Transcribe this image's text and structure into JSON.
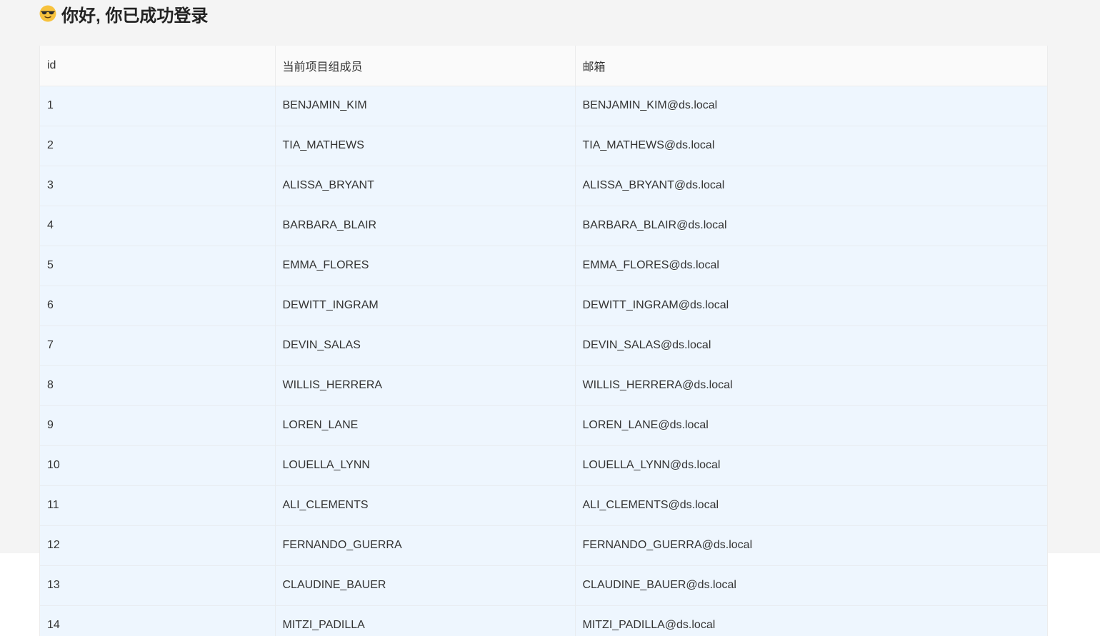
{
  "header": {
    "emoji_icon": "smiling-face-with-sunglasses",
    "greeting": "你好, 你已成功登录"
  },
  "table": {
    "columns": [
      "id",
      "当前项目组成员",
      "邮箱"
    ],
    "rows": [
      {
        "id": "1",
        "name": "BENJAMIN_KIM",
        "email": "BENJAMIN_KIM@ds.local"
      },
      {
        "id": "2",
        "name": "TIA_MATHEWS",
        "email": "TIA_MATHEWS@ds.local"
      },
      {
        "id": "3",
        "name": "ALISSA_BRYANT",
        "email": "ALISSA_BRYANT@ds.local"
      },
      {
        "id": "4",
        "name": "BARBARA_BLAIR",
        "email": "BARBARA_BLAIR@ds.local"
      },
      {
        "id": "5",
        "name": "EMMA_FLORES",
        "email": "EMMA_FLORES@ds.local"
      },
      {
        "id": "6",
        "name": "DEWITT_INGRAM",
        "email": "DEWITT_INGRAM@ds.local"
      },
      {
        "id": "7",
        "name": "DEVIN_SALAS",
        "email": "DEVIN_SALAS@ds.local"
      },
      {
        "id": "8",
        "name": "WILLIS_HERRERA",
        "email": "WILLIS_HERRERA@ds.local"
      },
      {
        "id": "9",
        "name": "LOREN_LANE",
        "email": "LOREN_LANE@ds.local"
      },
      {
        "id": "10",
        "name": "LOUELLA_LYNN",
        "email": "LOUELLA_LYNN@ds.local"
      },
      {
        "id": "11",
        "name": "ALI_CLEMENTS",
        "email": "ALI_CLEMENTS@ds.local"
      },
      {
        "id": "12",
        "name": "FERNANDO_GUERRA",
        "email": "FERNANDO_GUERRA@ds.local"
      },
      {
        "id": "13",
        "name": "CLAUDINE_BAUER",
        "email": "CLAUDINE_BAUER@ds.local"
      },
      {
        "id": "14",
        "name": "MITZI_PADILLA",
        "email": "MITZI_PADILLA@ds.local"
      }
    ]
  },
  "colors": {
    "page_background": "#f4f4f4",
    "header_row": "#fafafa",
    "body_row": "#eef6fe"
  }
}
